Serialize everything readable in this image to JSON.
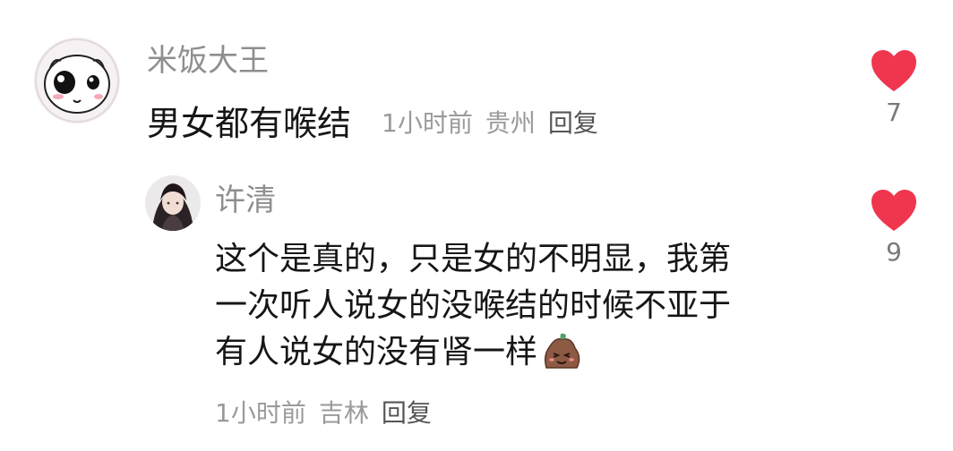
{
  "comments": [
    {
      "username": "米饭大王",
      "text": "男女都有喉结",
      "time": "1小时前",
      "location": "贵州",
      "reply_label": "回复",
      "likes": "7",
      "avatar_icon": "cartoon-face-icon"
    },
    {
      "username": "许清",
      "text_lines": [
        "这个是真的，只是女的不明显，我第",
        "一次听人说女的没喉结的时候不亚于",
        "有人说女的没有肾一样"
      ],
      "time": "1小时前",
      "location": "吉林",
      "reply_label": "回复",
      "likes": "9",
      "avatar_icon": "anime-character-icon",
      "emoji_icon": "smug-face-emoji-icon"
    }
  ],
  "colors": {
    "heart": "#f0364f",
    "username": "#8e8e8e",
    "text": "#161616",
    "meta": "#9a9a9a"
  }
}
